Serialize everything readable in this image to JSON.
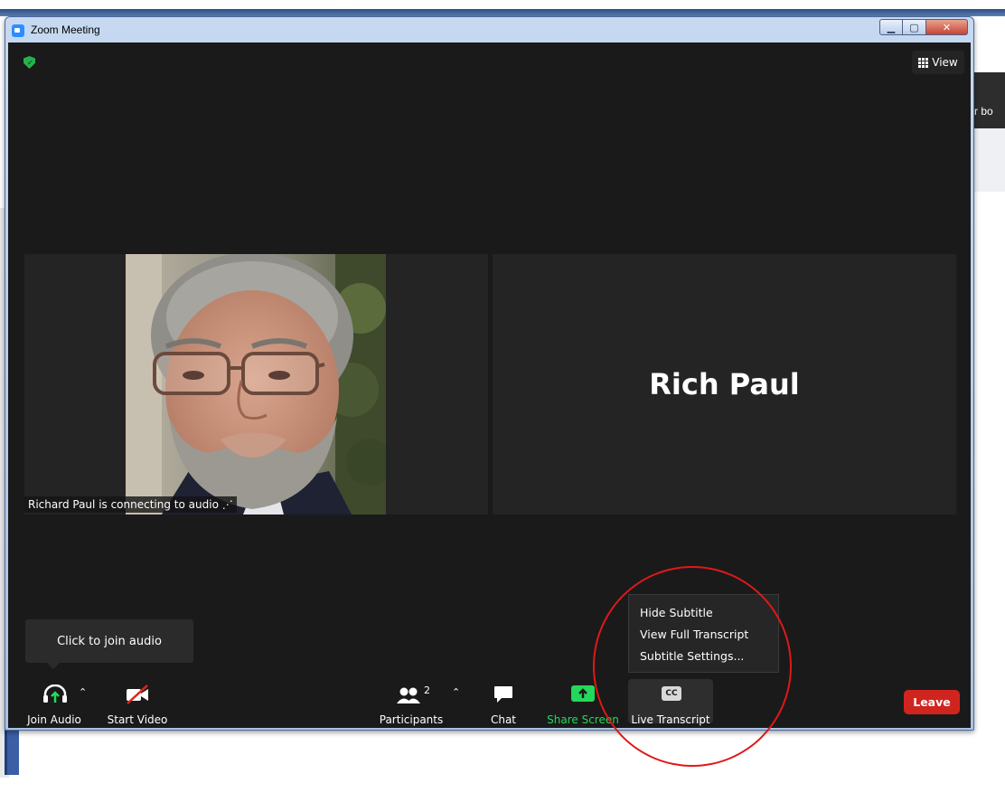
{
  "window": {
    "title": "Zoom Meeting"
  },
  "background": {
    "right_text": "r bo"
  },
  "top": {
    "view_label": "View"
  },
  "tiles": {
    "left_name_tag": "Richard Paul is connecting to audio",
    "right_name": "Rich Paul"
  },
  "tooltip": {
    "text": "Click to join audio"
  },
  "menu": {
    "items": [
      "Hide Subtitle",
      "View Full Transcript",
      "Subtitle Settings..."
    ]
  },
  "toolbar": {
    "join_audio": "Join Audio",
    "start_video": "Start Video",
    "participants": "Participants",
    "participants_count": "2",
    "chat": "Chat",
    "share_screen": "Share Screen",
    "live_transcript": "Live Transcript",
    "cc_badge": "CC",
    "leave": "Leave"
  },
  "colors": {
    "accent_green": "#23d959",
    "leave_red": "#d0251f",
    "annotation_red": "#e01818",
    "meeting_bg": "#1a1a1a"
  }
}
